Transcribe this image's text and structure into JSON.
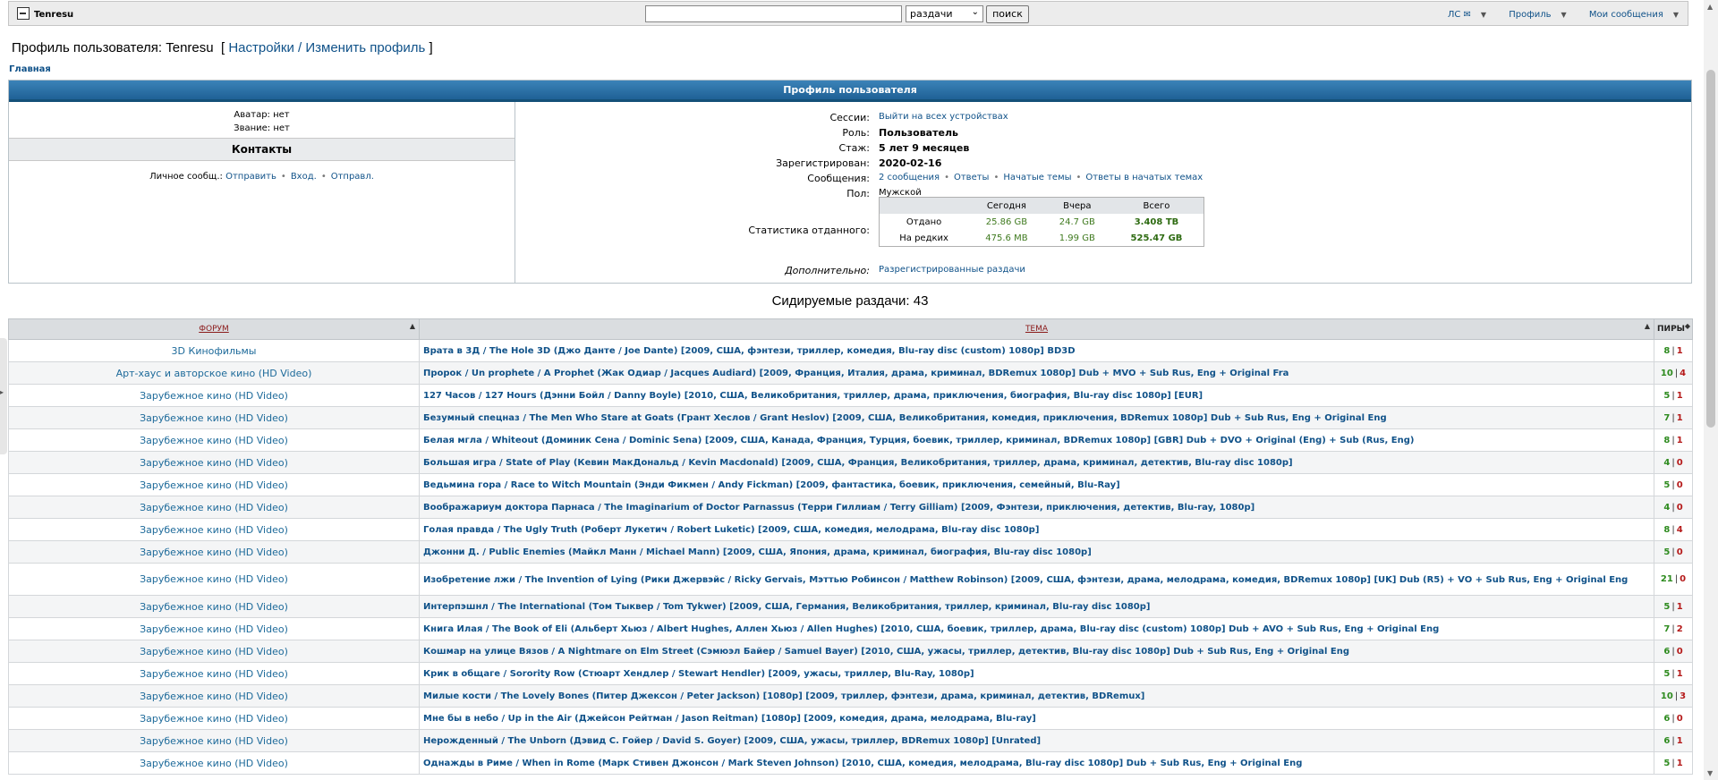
{
  "topbar": {
    "site_user": "Tenresu",
    "search_value": "",
    "search_scope": "раздачи",
    "search_button": "поиск",
    "nav": [
      {
        "label": "ЛС ✉"
      },
      {
        "label": "Профиль"
      },
      {
        "label": "Мои сообщения"
      }
    ]
  },
  "page": {
    "title_prefix": "Профиль пользователя:",
    "username": "Tenresu",
    "open_bracket": "[",
    "settings_link": "Настройки / Изменить профиль",
    "close_bracket": "]",
    "breadcrumb": "Главная"
  },
  "profile": {
    "header": "Профиль пользователя",
    "avatar": "Аватар: нет",
    "rank": "Звание: нет",
    "contacts_title": "Контакты",
    "pm_label": "Личное сообщ.:",
    "pm_links": [
      "Отправить",
      "Вход.",
      "Отправл."
    ],
    "sessions_label": "Сессии:",
    "sessions_link": "Выйти на всех устройствах",
    "role_label": "Роль:",
    "role_value": "Пользователь",
    "tenure_label": "Стаж:",
    "tenure_value": "5 лет 9 месяцев",
    "registered_label": "Зарегистрирован:",
    "registered_value": "2020-02-16",
    "messages_label": "Сообщения:",
    "messages_links": [
      "2 сообщения",
      "Ответы",
      "Начатые темы",
      "Ответы в начатых темах"
    ],
    "gender_label": "Пол:",
    "gender_value": "Мужской",
    "stats_label": "Статистика отданного:",
    "stats": {
      "headers": [
        "",
        "Сегодня",
        "Вчера",
        "Всего"
      ],
      "rows": [
        {
          "name": "Отдано",
          "today": "25.86 GB",
          "yesterday": "24.7 GB",
          "total": "3.408 TB"
        },
        {
          "name": "На редких",
          "today": "475.6 MB",
          "yesterday": "1.99 GB",
          "total": "525.47 GB"
        }
      ]
    },
    "extra_label": "Дополнительно:",
    "extra_link": "Разрегистрированные раздачи"
  },
  "seeding_title": "Сидируемые раздачи: 43",
  "table": {
    "col_forum": "ФОРУМ",
    "col_topic": "ТЕМА",
    "col_peers": "ПИРЫ",
    "rows": [
      {
        "forum": "3D Кинофильмы",
        "topic": "Врата в 3Д / The Hole 3D (Джо Данте / Joe Dante) [2009, США, фэнтези, триллер, комедия, Blu-ray disc (custom) 1080p] BD3D",
        "seeds": "8",
        "leech": "1"
      },
      {
        "forum": "Арт-хаус и авторское кино (HD Video)",
        "topic": "Пророк / Un prophete / A Prophet (Жак Одиар / Jacques Audiard) [2009, Франция, Италия, драма, криминал, BDRemux 1080p] Dub + MVO + Sub Rus, Eng + Original Fra",
        "seeds": "10",
        "leech": "4"
      },
      {
        "forum": "Зарубежное кино (HD Video)",
        "topic": "127 Часов / 127 Hours (Дэнни Бойл / Danny Boyle) [2010, США, Великобритания, триллер, драма, приключения, биография, Blu-ray disc 1080p] [EUR]",
        "seeds": "5",
        "leech": "1"
      },
      {
        "forum": "Зарубежное кино (HD Video)",
        "topic": "Безумный спецназ / The Men Who Stare at Goats (Грант Хеслов / Grant Heslov) [2009, США, Великобритания, комедия, приключения, BDRemux 1080p] Dub + Sub Rus, Eng + Original Eng",
        "seeds": "7",
        "leech": "1"
      },
      {
        "forum": "Зарубежное кино (HD Video)",
        "topic": "Белая мгла / Whiteout (Доминик Сена / Dominic Sena) [2009, США, Канада, Франция, Турция, боевик, триллер, криминал, BDRemux 1080p] [GBR] Dub + DVO + Original (Eng) + Sub (Rus, Eng)",
        "seeds": "8",
        "leech": "1"
      },
      {
        "forum": "Зарубежное кино (HD Video)",
        "topic": "Большая игра / State of Play (Кевин МакДональд / Kevin Macdonald) [2009, США, Франция, Великобритания, триллер, драма, криминал, детектив, Blu-ray disc 1080p]",
        "seeds": "4",
        "leech": "0"
      },
      {
        "forum": "Зарубежное кино (HD Video)",
        "topic": "Ведьмина гора / Race to Witch Mountain (Энди Фикмен / Andy Fickman) [2009, фантастика, боевик, приключения, семейный, Blu-Ray]",
        "seeds": "5",
        "leech": "0"
      },
      {
        "forum": "Зарубежное кино (HD Video)",
        "topic": "Воображариум доктора Парнаса / The Imaginarium of Doctor Parnassus (Терри Гиллиам / Terry Gilliam) [2009, Фэнтези, приключения, детектив, Blu-ray, 1080p]",
        "seeds": "4",
        "leech": "0"
      },
      {
        "forum": "Зарубежное кино (HD Video)",
        "topic": "Голая правда / The Ugly Truth (Роберт Лукетич / Robert Luketic) [2009, США, комедия, мелодрама, Blu-ray disc 1080p]",
        "seeds": "8",
        "leech": "4"
      },
      {
        "forum": "Зарубежное кино (HD Video)",
        "topic": "Джонни Д. / Public Enemies (Майкл Манн / Michael Mann) [2009, США, Япония, драма, криминал, биография, Blu-ray disc 1080p]",
        "seeds": "5",
        "leech": "0"
      },
      {
        "forum": "Зарубежное кино (HD Video)",
        "topic": "Изобретение лжи / The Invention of Lying (Рики Джервэйс / Ricky Gervais, Мэттью Робинсон / Matthew Robinson) [2009, США, фэнтези, драма, мелодрама, комедия, BDRemux 1080p] [UK] Dub (R5) + VO + Sub Rus, Eng + Original Eng",
        "seeds": "21",
        "leech": "0",
        "tall": true
      },
      {
        "forum": "Зарубежное кино (HD Video)",
        "topic": "Интерпэшнл / The International (Том Тыквер / Tom Tykwer) [2009, США, Германия, Великобритания, триллер, криминал, Blu-ray disc 1080p]",
        "seeds": "5",
        "leech": "1"
      },
      {
        "forum": "Зарубежное кино (HD Video)",
        "topic": "Книга Илая / The Book of Eli (Альберт Хьюз / Albert Hughes, Аллен Хьюз / Allen Hughes) [2010, США, боевик, триллер, драма, Blu-ray disc (custom) 1080p] Dub + AVO + Sub Rus, Eng + Original Eng",
        "seeds": "7",
        "leech": "2"
      },
      {
        "forum": "Зарубежное кино (HD Video)",
        "topic": "Кошмар на улице Вязов / A Nightmare on Elm Street (Сэмюэл Байер / Samuel Bayer) [2010, США, ужасы, триллер, детектив, Blu-ray disc 1080p] Dub + Sub Rus, Eng + Original Eng",
        "seeds": "6",
        "leech": "0"
      },
      {
        "forum": "Зарубежное кино (HD Video)",
        "topic": "Крик в общаге / Sorority Row (Стюарт Хендлер / Stewart Hendler) [2009, ужасы, триллер, Blu-Ray, 1080p]",
        "seeds": "5",
        "leech": "1"
      },
      {
        "forum": "Зарубежное кино (HD Video)",
        "topic": "Милые кости / The Lovely Bones (Питер Джексон / Peter Jackson) [1080p] [2009, триллер, фэнтези, драма, криминал, детектив, BDRemux]",
        "seeds": "10",
        "leech": "3"
      },
      {
        "forum": "Зарубежное кино (HD Video)",
        "topic": "Мне бы в небо / Up in the Air (Джейсон Рейтман / Jason Reitman) [1080p] [2009, комедия, драма, мелодрама, Blu-ray]",
        "seeds": "6",
        "leech": "0"
      },
      {
        "forum": "Зарубежное кино (HD Video)",
        "topic": "Нерожденный / The Unborn (Дэвид С. Гойер / David S. Goyer) [2009, США, ужасы, триллер, BDRemux 1080p] [Unrated]",
        "seeds": "6",
        "leech": "1"
      },
      {
        "forum": "Зарубежное кино (HD Video)",
        "topic": "Однажды в Риме / When in Rome (Марк Стивен Джонсон / Mark Steven Johnson) [2010, США, комедия, мелодрама, Blu-ray disc 1080p] Dub + Sub Rus, Eng + Original Eng",
        "seeds": "5",
        "leech": "1"
      }
    ]
  }
}
